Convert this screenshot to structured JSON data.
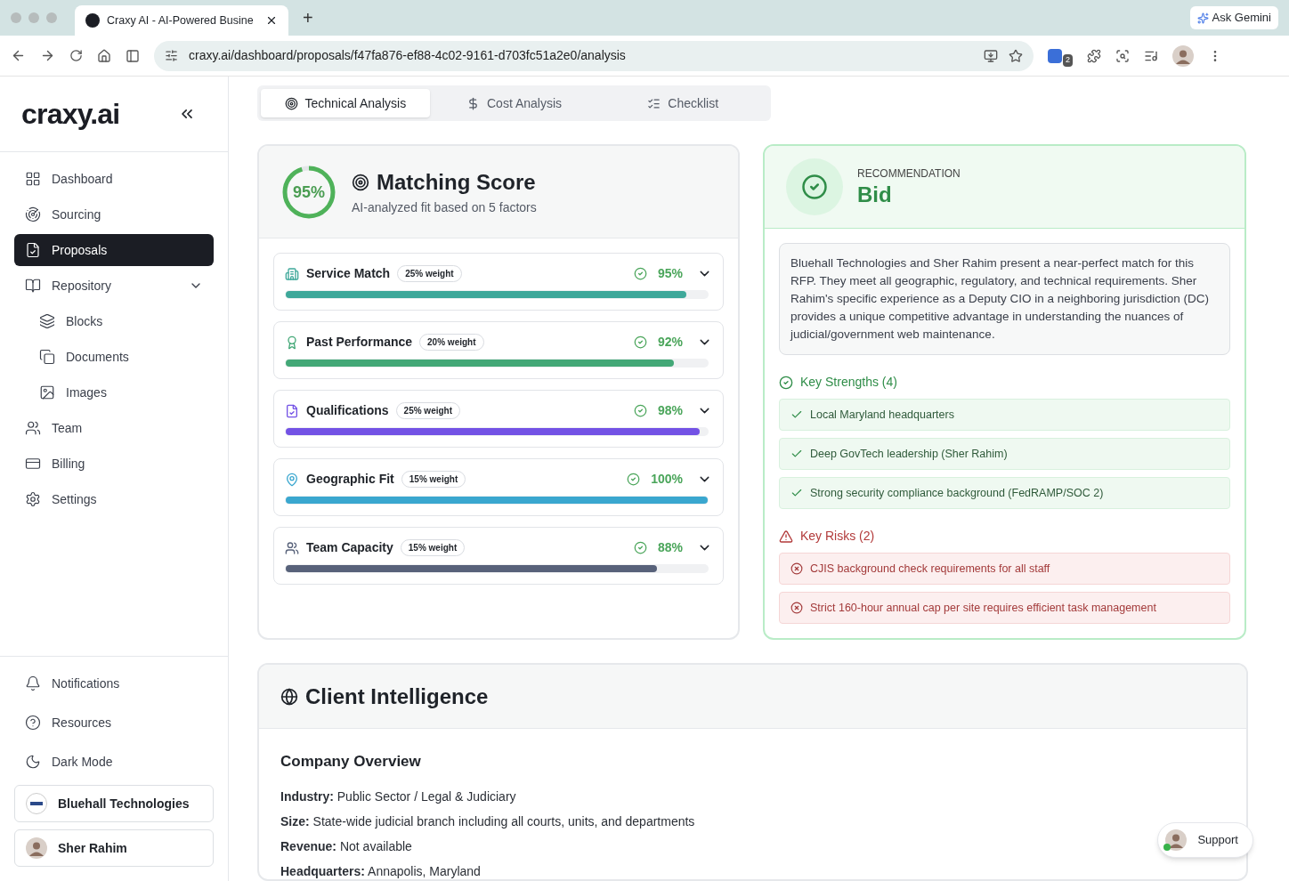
{
  "browser": {
    "tab_title": "Craxy AI - AI-Powered Busine",
    "new_tab": "+",
    "gemini": "Ask Gemini",
    "url": "craxy.ai/dashboard/proposals/f47fa876-ef88-4c02-9161-d703fc51a2e0/analysis",
    "extension_badge": "2"
  },
  "sidebar": {
    "logo": "craxy.ai",
    "items": [
      {
        "label": "Dashboard",
        "selected": false
      },
      {
        "label": "Sourcing",
        "selected": false
      },
      {
        "label": "Proposals",
        "selected": true
      },
      {
        "label": "Repository",
        "selected": false,
        "expanded": true,
        "children": [
          {
            "label": "Blocks",
            "selected": false
          },
          {
            "label": "Documents",
            "selected": false
          },
          {
            "label": "Images",
            "selected": false
          }
        ]
      },
      {
        "label": "Team",
        "selected": false
      },
      {
        "label": "Billing",
        "selected": false
      },
      {
        "label": "Settings",
        "selected": false
      }
    ],
    "bottom_items": [
      "Notifications",
      "Resources",
      "Dark Mode"
    ],
    "workspace": "Bluehall Technologies",
    "user": "Sher Rahim"
  },
  "tabs": [
    {
      "label": "Technical Analysis",
      "selected": true
    },
    {
      "label": "Cost Analysis",
      "selected": false
    },
    {
      "label": "Checklist",
      "selected": false
    }
  ],
  "matching": {
    "score": "95%",
    "level": 0.95,
    "title": "Matching Score",
    "subtitle": "AI-analyzed fit based on 5 factors",
    "factors": [
      {
        "name": "Service Match",
        "weight": "25% weight",
        "score": "95%",
        "level": 0.95,
        "color": "#3ea89a"
      },
      {
        "name": "Past Performance",
        "weight": "20% weight",
        "score": "92%",
        "level": 0.92,
        "color": "#43a877"
      },
      {
        "name": "Qualifications",
        "weight": "25% weight",
        "score": "98%",
        "level": 0.98,
        "color": "#7352e5"
      },
      {
        "name": "Geographic Fit",
        "weight": "15% weight",
        "score": "100%",
        "level": 1.0,
        "color": "#3aa7cf"
      },
      {
        "name": "Team Capacity",
        "weight": "15% weight",
        "score": "88%",
        "level": 0.88,
        "color": "#58627a"
      }
    ]
  },
  "recommendation": {
    "label": "RECOMMENDATION",
    "value": "Bid",
    "summary": "Bluehall Technologies and Sher Rahim present a near-perfect match for this RFP. They meet all geographic, regulatory, and technical requirements. Sher Rahim's specific experience as a Deputy CIO in a neighboring jurisdiction (DC) provides a unique competitive advantage in understanding the nuances of judicial/government web maintenance.",
    "strengths_title": "Key Strengths (4)",
    "strengths": [
      "Local Maryland headquarters",
      "Deep GovTech leadership (Sher Rahim)",
      "Strong security compliance background (FedRAMP/SOC 2)"
    ],
    "risks_title": "Key Risks (2)",
    "risks": [
      "CJIS background check requirements for all staff",
      "Strict 160-hour annual cap per site requires efficient task management"
    ]
  },
  "client": {
    "title": "Client Intelligence",
    "section": "Company Overview",
    "facts": [
      "**Industry:** Public Sector / Legal & Judiciary",
      "**Size:** State-wide judicial branch including all courts, units, and departments",
      "**Revenue:** Not available",
      "**Headquarters:** Annapolis, Maryland"
    ]
  },
  "support": "Support"
}
